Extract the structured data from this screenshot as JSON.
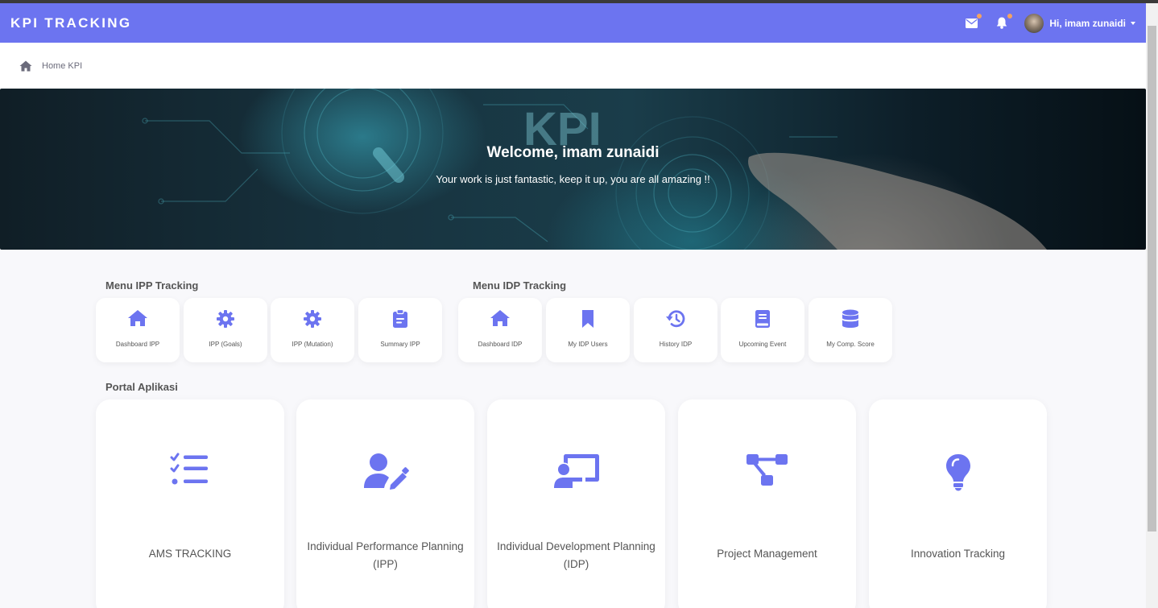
{
  "brand": "KPI TRACKING",
  "colors": {
    "navbar": "#6c74f0",
    "accent": "#6c74f0",
    "notification_dot": "#f4a261"
  },
  "header": {
    "icons": [
      "envelope-icon",
      "bell-icon"
    ],
    "user_greeting": "Hi, imam zunaidi"
  },
  "breadcrumb": {
    "icon": "home-icon",
    "label": "Home KPI"
  },
  "hero": {
    "title": "Welcome, imam zunaidi",
    "subtitle": "Your work is just fantastic, keep it up, you are all amazing !!"
  },
  "ipp_menu": {
    "title": "Menu IPP Tracking",
    "items": [
      {
        "label": "Dashboard IPP",
        "icon": "home-icon"
      },
      {
        "label": "IPP (Goals)",
        "icon": "gear-icon"
      },
      {
        "label": "IPP (Mutation)",
        "icon": "gear-icon"
      },
      {
        "label": "Summary IPP",
        "icon": "clipboard-icon"
      }
    ]
  },
  "idp_menu": {
    "title": "Menu IDP Tracking",
    "items": [
      {
        "label": "Dashboard IDP",
        "icon": "home-icon"
      },
      {
        "label": "My IDP Users",
        "icon": "bookmark-icon"
      },
      {
        "label": "History IDP",
        "icon": "history-icon"
      },
      {
        "label": "Upcoming Event",
        "icon": "book-icon"
      },
      {
        "label": "My Comp. Score",
        "icon": "database-icon"
      }
    ]
  },
  "portal": {
    "title": "Portal Aplikasi",
    "items": [
      {
        "label": "AMS TRACKING",
        "icon": "tasks-list-icon"
      },
      {
        "label": "Individual Performance Planning (IPP)",
        "icon": "user-edit-icon"
      },
      {
        "label": "Individual Development Planning (IDP)",
        "icon": "chalkboard-teacher-icon"
      },
      {
        "label": "Project Management",
        "icon": "project-diagram-icon"
      },
      {
        "label": "Innovation Tracking",
        "icon": "lightbulb-icon"
      }
    ]
  }
}
